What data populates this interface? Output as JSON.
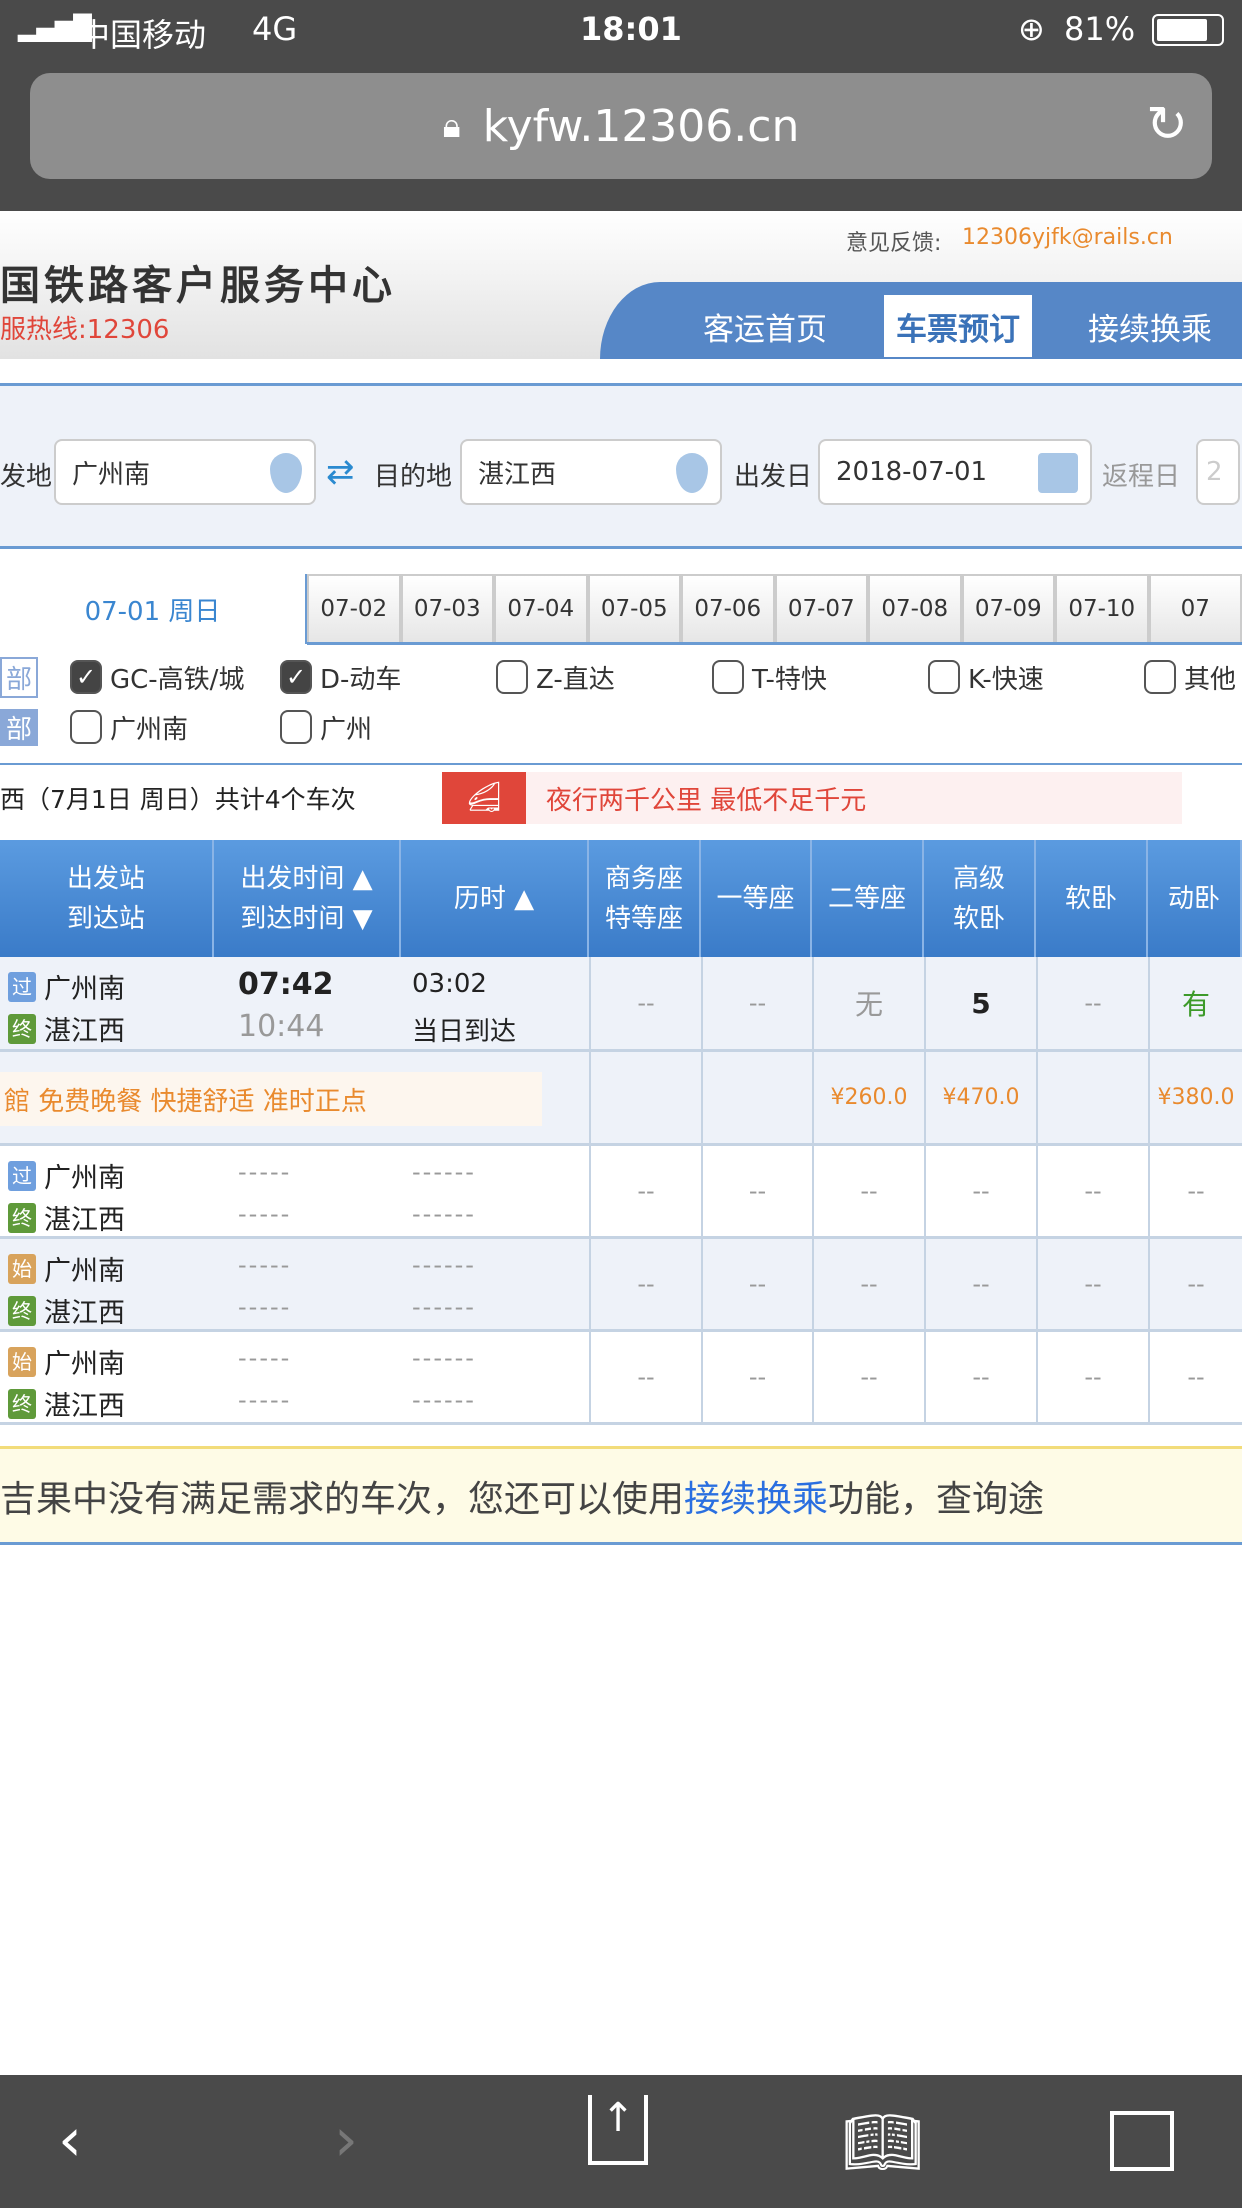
{
  "status_bar": {
    "carrier": "中国移动",
    "network": "4G",
    "time": "18:01",
    "battery": "81%"
  },
  "browser": {
    "url": "kyfw.12306.cn"
  },
  "header": {
    "title": "国铁路客户服务中心",
    "hotline": "服热线:12306",
    "feedback_label": "意见反馈:",
    "feedback_email": "12306yjfk@rails.cn",
    "nav": [
      "客运首页",
      "车票预订",
      "接续换乘"
    ],
    "active_nav": "车票预订"
  },
  "search": {
    "from_label": "发地",
    "from_value": "广州南",
    "to_label": "目的地",
    "to_value": "湛江西",
    "date_label": "出发日",
    "date_value": "2018-07-01",
    "return_label": "返程日",
    "return_value": "2"
  },
  "date_tabs": {
    "active": "07-01 周日",
    "dates": [
      "07-02",
      "07-03",
      "07-04",
      "07-05",
      "07-06",
      "07-07",
      "07-08",
      "07-09",
      "07-10",
      "07"
    ]
  },
  "filters": {
    "type_all": "部",
    "types": [
      {
        "label": "GC-高铁/城",
        "checked": true
      },
      {
        "label": "D-动车",
        "checked": true
      },
      {
        "label": "Z-直达",
        "checked": false
      },
      {
        "label": "T-特快",
        "checked": false
      },
      {
        "label": "K-快速",
        "checked": false
      },
      {
        "label": "其他",
        "checked": false
      }
    ],
    "station_all": "部",
    "stations": [
      {
        "label": "广州南",
        "checked": false
      },
      {
        "label": "广州",
        "checked": false
      }
    ]
  },
  "summary": {
    "text": "西（7月1日  周日）共计4个车次",
    "ad": "夜行两千公里 最低不足千元"
  },
  "table": {
    "headers": [
      [
        "出发站",
        "到达站"
      ],
      [
        "出发时间 ▲",
        "到达时间 ▼"
      ],
      [
        "历时 ▲"
      ],
      [
        "商务座",
        "特等座"
      ],
      [
        "一等座"
      ],
      [
        "二等座"
      ],
      [
        "高级",
        "软卧"
      ],
      [
        "软卧"
      ],
      [
        "动卧"
      ]
    ],
    "row1": {
      "from_badge": "过",
      "from": "广州南",
      "to_badge": "终",
      "to": "湛江西",
      "depart": "07:42",
      "arrive": "10:44",
      "duration": "03:02",
      "arrival_day": "当日到达",
      "seats": [
        "--",
        "--",
        "无",
        "5",
        "--",
        "有"
      ]
    },
    "promo": {
      "text": "館 免费晚餐 快捷舒适 准时正点",
      "prices": [
        "",
        "",
        "¥260.0",
        "¥470.0",
        "",
        "¥380.0"
      ]
    },
    "rows": [
      {
        "from_badge": "过",
        "from": "广州南",
        "to_badge": "终",
        "to": "湛江西",
        "depart": "-----",
        "arrive": "-----",
        "duration": "------",
        "arrival_day": "------",
        "seats": [
          "--",
          "--",
          "--",
          "--",
          "--",
          "--"
        ]
      },
      {
        "from_badge": "始",
        "from": "广州南",
        "to_badge": "终",
        "to": "湛江西",
        "depart": "-----",
        "arrive": "-----",
        "duration": "------",
        "arrival_day": "------",
        "seats": [
          "--",
          "--",
          "--",
          "--",
          "--",
          "--"
        ]
      },
      {
        "from_badge": "始",
        "from": "广州南",
        "to_badge": "终",
        "to": "湛江西",
        "depart": "-----",
        "arrive": "-----",
        "duration": "------",
        "arrival_day": "------",
        "seats": [
          "--",
          "--",
          "--",
          "--",
          "--",
          "--"
        ]
      }
    ]
  },
  "notice": {
    "before": "吉果中没有满足需求的车次，您还可以使用",
    "link": "接续换乘",
    "after": " 功能，查询途"
  },
  "colors": {
    "brand_blue": "#5687c7",
    "orange": "#e98a2e",
    "green": "#3d9a2a",
    "link": "#2a6fe0"
  }
}
